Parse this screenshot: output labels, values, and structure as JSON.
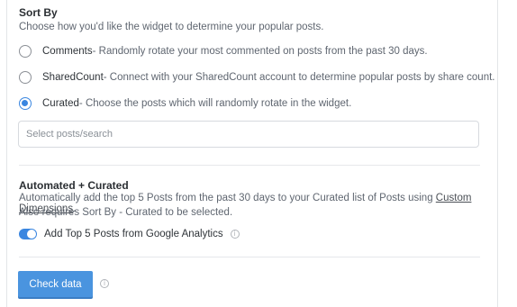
{
  "sort_by": {
    "title": "Sort By",
    "description": "Choose how you'd like the widget to determine your popular posts.",
    "options": [
      {
        "name": "Comments",
        "desc": " - Randomly rotate your most commented on posts from the past 30 days.",
        "checked": false
      },
      {
        "name": "SharedCount",
        "desc": " - Connect with your SharedCount account to determine popular posts by share count.",
        "checked": false
      },
      {
        "name": "Curated",
        "desc": " - Choose the posts which will randomly rotate in the widget.",
        "checked": true
      }
    ],
    "search_placeholder": "Select posts/search"
  },
  "automated": {
    "title": "Automated + Curated",
    "line1_prefix": "Automatically add the top 5 Posts from the past 30 days to your Curated list of Posts using ",
    "line1_link": "Custom Dimensions",
    "line1_suffix": ".",
    "line2": "Also requires Sort By - Curated to be selected.",
    "toggle_label": "Add Top 5 Posts from Google Analytics",
    "toggle_on": true
  },
  "button": {
    "label": "Check data"
  },
  "colors": {
    "accent": "#3a86e0",
    "button": "#4a94df"
  }
}
